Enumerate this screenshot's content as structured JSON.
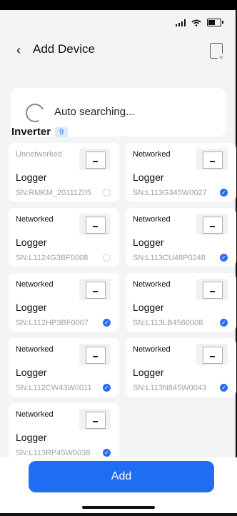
{
  "header": {
    "title": "Add Device"
  },
  "search": {
    "text": "Auto searching..."
  },
  "section": {
    "title": "Inverter",
    "count": "9"
  },
  "devices": [
    {
      "status": "Unnetworked",
      "name": "Logger",
      "sn": "SN:RMKM_20111Z05",
      "selected": false
    },
    {
      "status": "Networked",
      "name": "Logger",
      "sn": "SN:L113G345W0027",
      "selected": true
    },
    {
      "status": "Networked",
      "name": "Logger",
      "sn": "SN:L1124G3BF0008",
      "selected": false
    },
    {
      "status": "Networked",
      "name": "Logger",
      "sn": "SN:L113CU48P0248",
      "selected": true
    },
    {
      "status": "Networked",
      "name": "Logger",
      "sn": "SN:L112HP3BF0007",
      "selected": true
    },
    {
      "status": "Networked",
      "name": "Logger",
      "sn": "SN:L113LB4560008",
      "selected": true
    },
    {
      "status": "Networked",
      "name": "Logger",
      "sn": "SN:L112CW43W0011",
      "selected": true
    },
    {
      "status": "Networked",
      "name": "Logger",
      "sn": "SN:L113N845W0043",
      "selected": true
    },
    {
      "status": "Networked",
      "name": "Logger",
      "sn": "SN:L113RP45W0038",
      "selected": true
    }
  ],
  "actions": {
    "add_label": "Add"
  },
  "colors": {
    "accent": "#1f6df0",
    "dim_text": "#9aa1aa",
    "background": "#f3f4f6"
  }
}
